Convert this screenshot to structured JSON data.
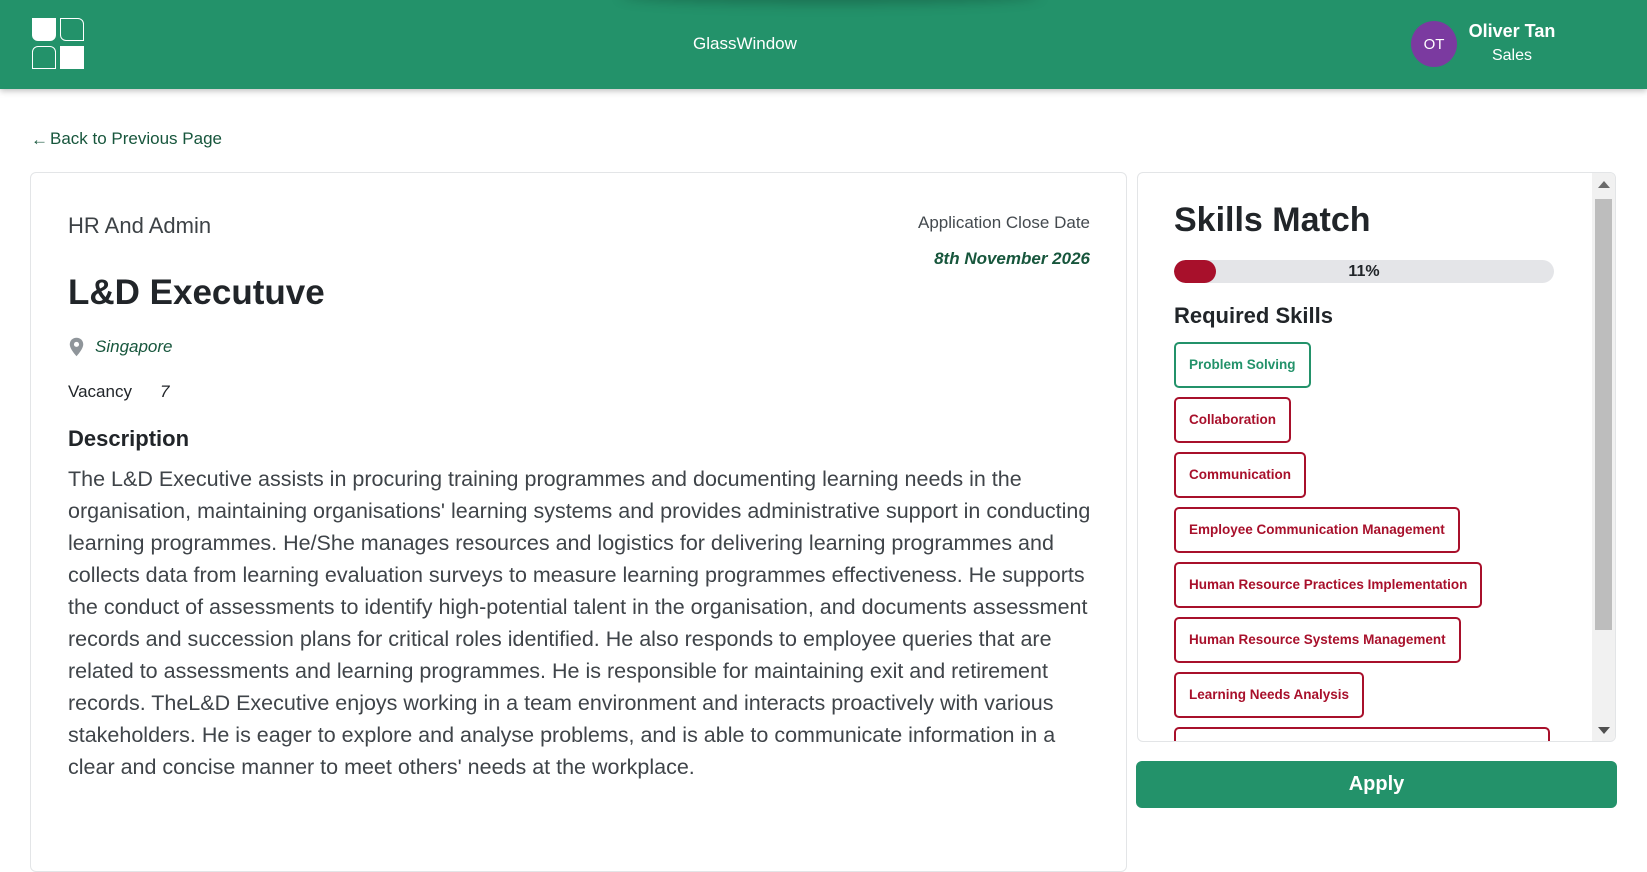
{
  "header": {
    "brand": "GlassWindow",
    "user": {
      "initials": "OT",
      "name": "Oliver Tan",
      "role": "Sales"
    },
    "colors": {
      "bar": "#23926a",
      "avatar": "#7b3aa0"
    }
  },
  "nav": {
    "back_label": "Back to Previous Page",
    "back_icon": "arrow-left-icon"
  },
  "job": {
    "department": "HR And Admin",
    "close_date_label": "Application Close Date",
    "close_date": "8th November 2026",
    "title": "L&D Executuve",
    "location": "Singapore",
    "vacancy_label": "Vacancy",
    "vacancy_value": "7",
    "description_title": "Description",
    "description": "The L&D Executive assists in procuring training programmes and documenting learning needs in the organisation, maintaining organisations' learning systems and provides administrative support in conducting learning programmes. He/She manages resources and logistics for delivering learning programmes and collects data from learning evaluation surveys to measure learning programmes effectiveness. He supports the conduct of assessments to identify high-potential talent in the organisation, and documents assessment records and succession plans for critical roles identified. He also responds to employee queries that are related to assessments and learning programmes. He is responsible for maintaining exit and retirement records. TheL&D Executive enjoys working in a team environment and interacts proactively with various stakeholders. He is eager to explore and analyse problems, and is able to communicate information in a clear and concise manner to meet others' needs at the workplace."
  },
  "skills": {
    "title": "Skills Match",
    "match_percent": 11,
    "match_label": "11%",
    "required_title": "Required Skills",
    "items": [
      {
        "label": "Problem Solving",
        "matched": true
      },
      {
        "label": "Collaboration",
        "matched": false
      },
      {
        "label": "Communication",
        "matched": false
      },
      {
        "label": "Employee Communication Management",
        "matched": false
      },
      {
        "label": "Human Resource Practices Implementation",
        "matched": false
      },
      {
        "label": "Human Resource Systems Management",
        "matched": false
      },
      {
        "label": "Learning Needs Analysis",
        "matched": false
      },
      {
        "label": "",
        "matched": false
      }
    ],
    "colors": {
      "matched": "#23926a",
      "unmatched": "#a8102b",
      "bar_fill": "#a8102b"
    }
  },
  "actions": {
    "apply_label": "Apply"
  }
}
